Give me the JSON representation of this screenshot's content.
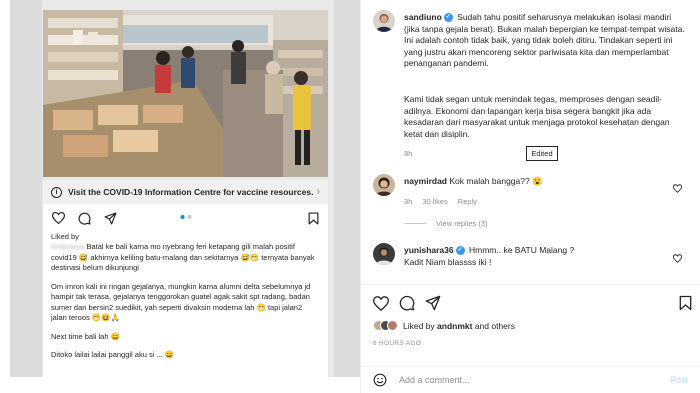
{
  "embedded_post": {
    "banner_text": "Visit the COVID-19 Information Centre for vaccine resources.",
    "liked_by_label": "Liked by",
    "caption_user": "lorilpowsa",
    "caption_lines": [
      "Batal ke bali karna mo nyebrang feri ketapang gili malah positif covid19 😅 akhirnya keliling batu-malang dan sekitarnya 😅😁 ternyata banyak destinasi belum dikunjungi"
    ],
    "paragraph_2": "Om imron kali ini ringan gejalanya, mungkin karna alumni delta sebelumnya jd hampir tak terasa, gejalanya tenggorokan guatel agak sakit spt radang, badan sumer dan bersin2 suedikit, yah seperti divaksin moderna lah 😁 tapi jalan2 jalan teroos 😁😆🙏",
    "paragraph_3": "Next time bali lah 😄",
    "paragraph_4": "Ditoko lailai lailai panggil aku si ... 😄"
  },
  "comments": {
    "main": {
      "username": "sandiuno",
      "text": "Sudah tahu positif seharusnya melakukan isolasi mandiri (jika tanpa gejala berat). Bukan malah bepergian ke tempat-tempat wisata. Ini adalah contoh tidak baik, yang tidak boleh ditiru. Tindakan seperti ini yang justru akan mencoreng sektor pariwisata kita dan memperlambat penanganan pandemi.",
      "text_2": "Kami tidak segan untuk menindak tegas, memproses dengan seadil-adilnya. Ekonomi dan lapangan kerja bisa segera bangkit jika ada kesadaran dari masyarakat untuk menjaga protokol kesehatan dengan ketat dan disiplin.",
      "time": "8h",
      "edited_label": "Edited"
    },
    "c1": {
      "username": "naymirdad",
      "text": "Kok malah bangga?? 😮",
      "time": "3h",
      "likes": "30 likes",
      "reply": "Reply",
      "view_replies": "View replies (3)"
    },
    "c2": {
      "username": "yunishara36",
      "text": "Hmmm.. ke BATU Malang ?",
      "text_2": "Kadit Niam blassss iki !"
    }
  },
  "footer": {
    "liked_by_prefix": "Liked by ",
    "liked_user": "andnmkt",
    "liked_suffix": " and others",
    "timestamp": "8 HOURS AGO",
    "comment_placeholder": "Add a comment...",
    "post_label": "Post"
  },
  "colors": {
    "verified": "#3897f0",
    "muted": "#8e8e8e",
    "post_button": "#b3dbff",
    "dot_active": "#0095f6"
  },
  "icons": [
    "heart-icon",
    "comment-icon",
    "share-icon",
    "bookmark-icon",
    "info-icon",
    "chevron-right-icon",
    "emoji-icon",
    "verified-icon"
  ]
}
